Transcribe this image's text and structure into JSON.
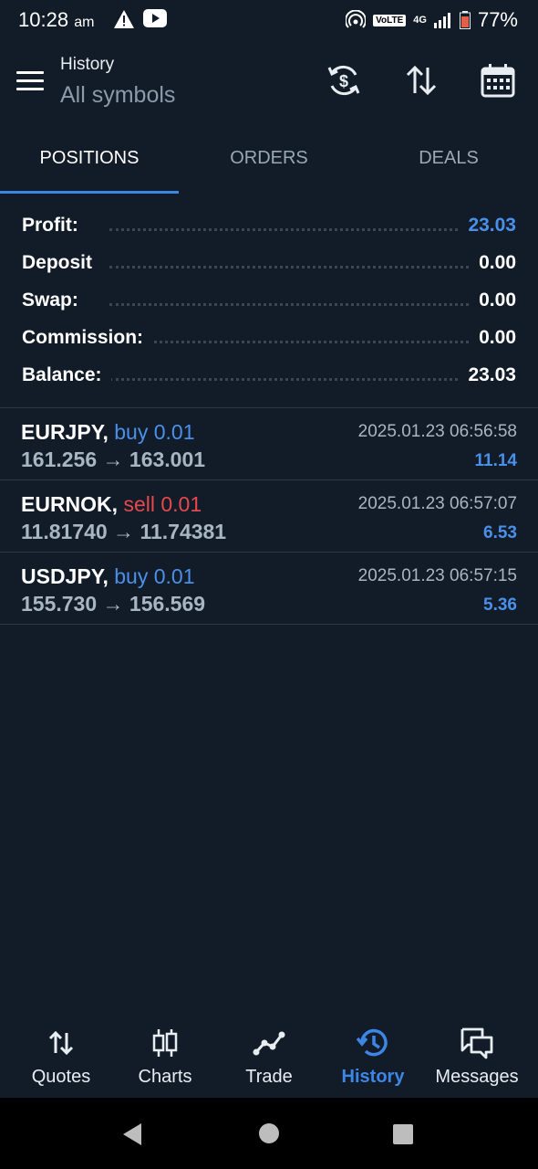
{
  "status_bar": {
    "time": "10:28",
    "ampm": "am",
    "network": "4G",
    "volte": "VoLTE",
    "battery": "77%"
  },
  "header": {
    "title": "History",
    "subtitle": "All symbols"
  },
  "tabs": [
    {
      "label": "POSITIONS"
    },
    {
      "label": "ORDERS"
    },
    {
      "label": "DEALS"
    }
  ],
  "summary": [
    {
      "label": "Profit:",
      "value": "23.03"
    },
    {
      "label": "Deposit",
      "value": "0.00"
    },
    {
      "label": "Swap:",
      "value": "0.00"
    },
    {
      "label": "Commission:",
      "value": "0.00"
    },
    {
      "label": "Balance:",
      "value": "23.03"
    }
  ],
  "deals": [
    {
      "symbol": "EURJPY,",
      "side": "buy 0.01",
      "prices": "161.256 → 163.001",
      "time": "2025.01.23 06:56:58",
      "profit": "11.14"
    },
    {
      "symbol": "EURNOK,",
      "side": "sell 0.01",
      "prices": "11.81740 → 11.74381",
      "time": "2025.01.23 06:57:07",
      "profit": "6.53"
    },
    {
      "symbol": "USDJPY,",
      "side": "buy 0.01",
      "prices": "155.730 → 156.569",
      "time": "2025.01.23 06:57:15",
      "profit": "5.36"
    }
  ],
  "bottom_nav": [
    {
      "label": "Quotes",
      "icon": "quotes-icon"
    },
    {
      "label": "Charts",
      "icon": "charts-icon"
    },
    {
      "label": "Trade",
      "icon": "trade-icon"
    },
    {
      "label": "History",
      "icon": "history-icon"
    },
    {
      "label": "Messages",
      "icon": "messages-icon"
    }
  ],
  "colors": {
    "background": "#121c28",
    "accent": "#3d86e6",
    "buy": "#4a90ea",
    "sell": "#e5484d"
  }
}
